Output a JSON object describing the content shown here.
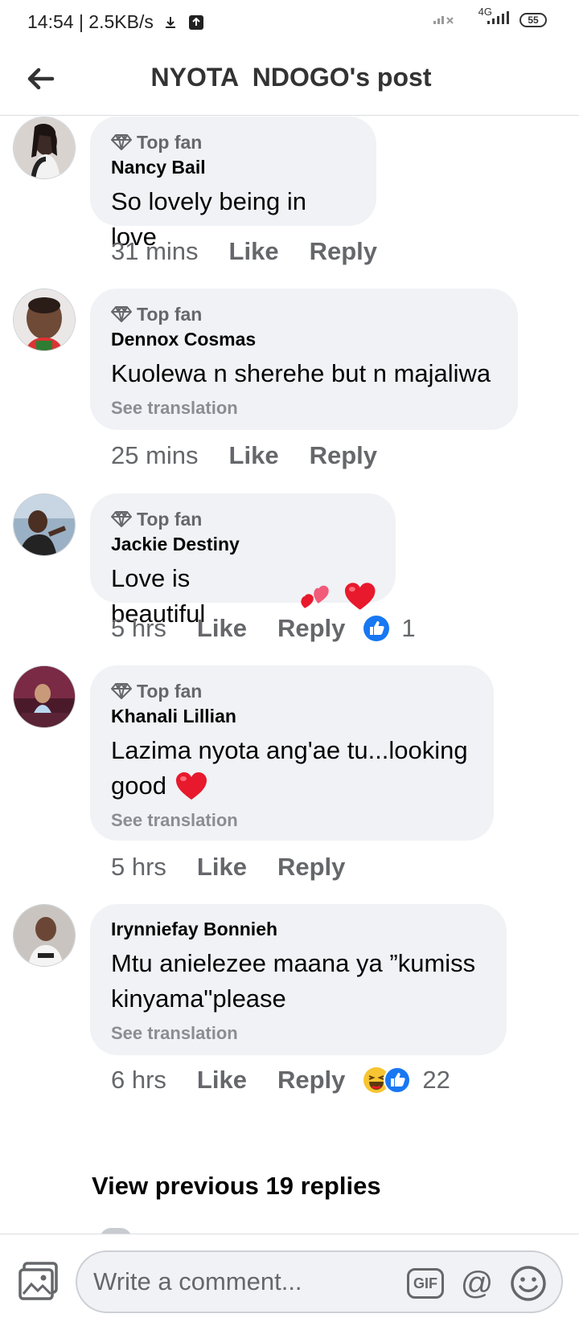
{
  "status_bar": {
    "left_text": "14:54 | 2.5KB/s",
    "network": "4G",
    "battery": "55"
  },
  "header": {
    "title": "NYOTA  NDOGO's post"
  },
  "comments": [
    {
      "badge": "Top fan",
      "author": "Nancy Bail",
      "text": "So lovely being in love",
      "time": "31 mins",
      "like": "Like",
      "reply": "Reply"
    },
    {
      "badge": "Top fan",
      "author": "Dennox Cosmas",
      "text": "Kuolewa n sherehe but n majaliwa",
      "see_translation": "See translation",
      "time": "25 mins",
      "like": "Like",
      "reply": "Reply"
    },
    {
      "badge": "Top fan",
      "author": "Jackie Destiny",
      "text": "Love is beautiful",
      "time": "5 hrs",
      "like": "Like",
      "reply": "Reply",
      "reaction_count": "1"
    },
    {
      "badge": "Top fan",
      "author": "Khanali Lillian",
      "text_line1": "Lazima nyota ang'ae tu...looking",
      "text_line2": "good",
      "see_translation": "See translation",
      "time": "5 hrs",
      "like": "Like",
      "reply": "Reply"
    },
    {
      "author": "Irynniefay Bonnieh",
      "text_line1": "Mtu anielezee maana ya ”kumiss",
      "text_line2": "kinyama\"please",
      "see_translation": "See translation",
      "time": "6 hrs",
      "like": "Like",
      "reply": "Reply",
      "reaction_count": "22"
    }
  ],
  "view_previous": "View previous 19 replies",
  "composer": {
    "placeholder": "Write a comment...",
    "gif_label": "GIF",
    "at_label": "@"
  },
  "colors": {
    "bubble": "#f0f2f5",
    "secondary_text": "#65676b",
    "like_blue": "#1877f2",
    "heart_red": "#e8192c"
  }
}
